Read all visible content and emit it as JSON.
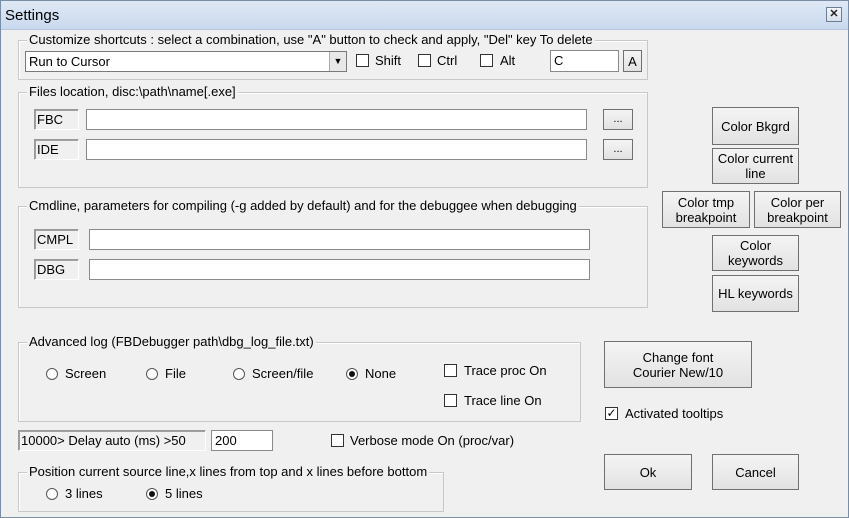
{
  "window": {
    "title": "Settings",
    "close_glyph": "✕"
  },
  "shortcuts": {
    "group_title": "Customize shortcuts : select a combination, use \"A\" button to check and apply, \"Del\" key To delete",
    "combo_value": "Run to Cursor",
    "shift_label": "Shift",
    "ctrl_label": "Ctrl",
    "alt_label": "Alt",
    "key_value": "C",
    "apply_label": "A"
  },
  "files": {
    "group_title": "Files location, disc:\\path\\name[.exe]",
    "fbc_label": "FBC",
    "ide_label": "IDE",
    "fbc_value": "",
    "ide_value": "",
    "browse_label": "..."
  },
  "cmdline": {
    "group_title": "Cmdline, parameters for compiling (-g added by default) and for the debuggee when debugging",
    "cmpl_label": "CMPL",
    "dbg_label": "DBG",
    "cmpl_value": "",
    "dbg_value": ""
  },
  "colors": {
    "bkgrd": "Color Bkgrd",
    "current_line": "Color current line",
    "tmp_breakpoint": "Color tmp breakpoint",
    "per_breakpoint": "Color per breakpoint",
    "keywords": "Color keywords",
    "hl_keywords": "HL keywords"
  },
  "log": {
    "group_title": "Advanced log (FBDebugger path\\dbg_log_file.txt)",
    "options": [
      "Screen",
      "File",
      "Screen/file",
      "None"
    ],
    "selected": "None",
    "trace_proc": "Trace proc On",
    "trace_line": "Trace line On"
  },
  "font": {
    "button_label": "Change font Courier New/10"
  },
  "tooltips": {
    "label": "Activated tooltips",
    "checked": true,
    "check_glyph": "✓"
  },
  "delay": {
    "label": "10000> Delay auto (ms) >50",
    "value": "200"
  },
  "verbose": {
    "label": "Verbose mode On (proc/var)"
  },
  "position": {
    "group_title": "Position current source line,x lines from top and x lines before bottom",
    "options": [
      "3 lines",
      "5 lines"
    ],
    "selected": "5 lines"
  },
  "actions": {
    "ok": "Ok",
    "cancel": "Cancel"
  },
  "glyphs": {
    "dropdown": "▼"
  }
}
